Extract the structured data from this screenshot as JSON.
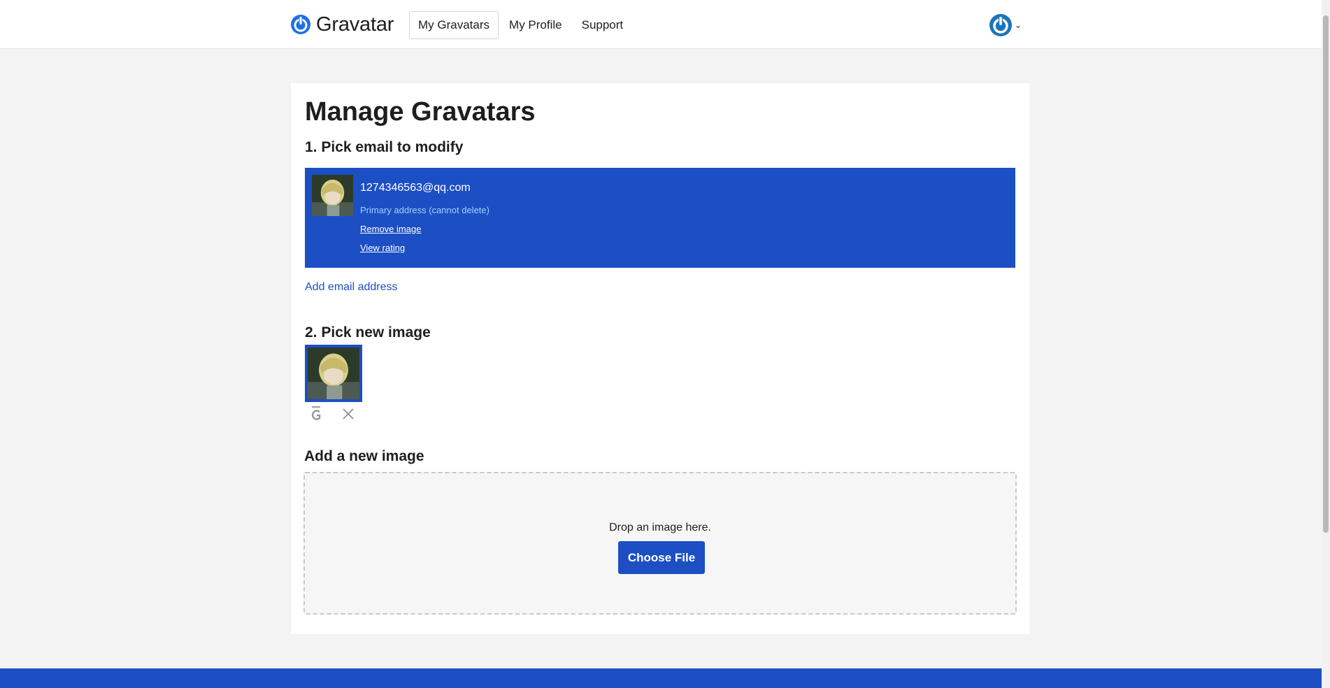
{
  "header": {
    "logo_text": "Gravatar",
    "nav": [
      {
        "label": "My Gravatars"
      },
      {
        "label": "My Profile"
      },
      {
        "label": "Support"
      }
    ]
  },
  "main": {
    "title": "Manage Gravatars",
    "step1_heading": "1. Pick email to modify",
    "email": {
      "address": "1274346563@qq.com",
      "primary_note": "Primary address (cannot delete)",
      "remove_label": "Remove image",
      "rating_label": "View rating"
    },
    "add_email_label": "Add email address",
    "step2_heading": "2. Pick new image",
    "add_image_heading": "Add a new image",
    "dropzone": {
      "text": "Drop an image here.",
      "button_label": "Choose File"
    }
  },
  "colors": {
    "accent": "#1d4fc4",
    "link": "#1d4fc4",
    "primary_note": "#9fd0ff",
    "page_bg": "#f3f3f3"
  },
  "icons": [
    "gravatar-logo-icon",
    "user-avatar-icon",
    "chevron-down-icon",
    "rated-g-icon",
    "close-icon"
  ]
}
